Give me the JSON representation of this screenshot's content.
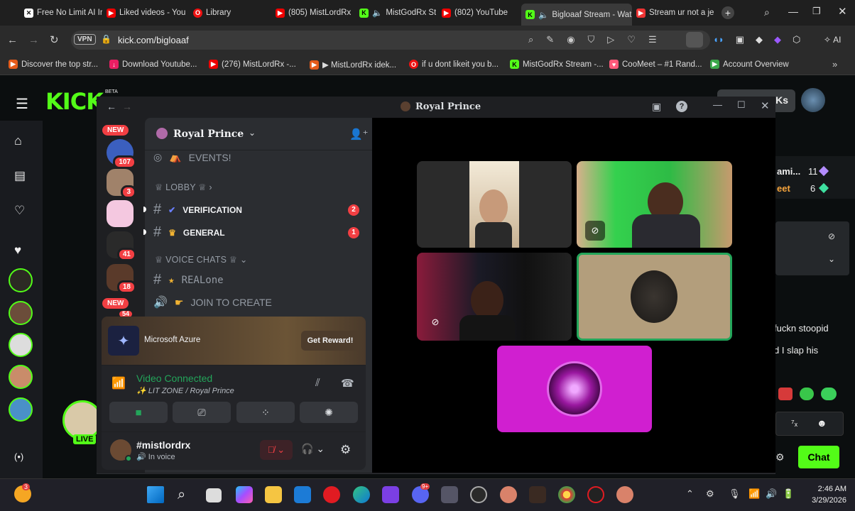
{
  "browser": {
    "tabs": [
      {
        "label": "Free No Limit AI Ir",
        "icon": "close-icon"
      },
      {
        "label": "Liked videos - You",
        "icon": "youtube-icon"
      },
      {
        "label": "Library",
        "icon": "opera-icon"
      },
      {
        "label": "(805) MistLordRx",
        "icon": "youtube-icon"
      },
      {
        "label": "MistGodRx Str",
        "icon": "kick-icon"
      },
      {
        "label": "(802) YouTube",
        "icon": "youtube-icon"
      },
      {
        "label": "Bigloaaf Stream - Wat",
        "icon": "kick-icon",
        "active": true
      },
      {
        "label": "Stream ur not a je",
        "icon": "stream-icon"
      }
    ],
    "url": "kick.com/bigloaaf",
    "vpn": "VPN",
    "ai_label": "AI",
    "bookmarks": [
      "Discover the top str...",
      "Download Youtube...",
      "(276) MistLordRx -...",
      "▶ MistLordRx idek...",
      "if u dont likeit you b...",
      "MistGodRx Stream -...",
      "CooMeet – #1 Rand...",
      "Account Overview"
    ]
  },
  "kick": {
    "logo": "KICK",
    "beta": "BETA",
    "follow_label": "Ks",
    "chat_lines": [
      {
        "name": "ami...",
        "count": "11"
      },
      {
        "name": "eet",
        "count": "6"
      }
    ],
    "chat_messages": [
      "fuckn stoopid",
      "d I slap his"
    ],
    "chat_button": "Chat",
    "live_badge": "LIVE",
    "live_indicator": "(•)"
  },
  "discord": {
    "window_title": "Royal Prince",
    "server_name": "Royal Prince",
    "guild_badges": [
      "NEW",
      "107",
      "3",
      "41",
      "18",
      "NEW",
      "54"
    ],
    "channels": [
      {
        "name": "EVENTS!",
        "type": "event"
      },
      {
        "category": "LOBBY"
      },
      {
        "name": "VERIFICATION",
        "unread": "2"
      },
      {
        "name": "GENERAL",
        "unread": "1"
      },
      {
        "category": "VOICE CHATS"
      },
      {
        "name": "REALone",
        "type": "text"
      },
      {
        "name": "JOIN TO CREATE",
        "type": "voice"
      }
    ],
    "ad": {
      "name": "Microsoft Azure",
      "cta": "Get Reward!"
    },
    "voice": {
      "status": "Video Connected",
      "location": "LIT ZONE / Royal Prince"
    },
    "user": {
      "name": "#mistlordrx",
      "status": "In voice"
    }
  },
  "taskbar": {
    "time": "2:46 AM",
    "date": "3/29/2026",
    "start_badge": "3",
    "discord_badge": "9+"
  },
  "colors": {
    "kick_green": "#53fc18",
    "discord_red": "#f23f43",
    "speaking_green": "#23a55a",
    "pink_tile": "#d01fd0"
  }
}
